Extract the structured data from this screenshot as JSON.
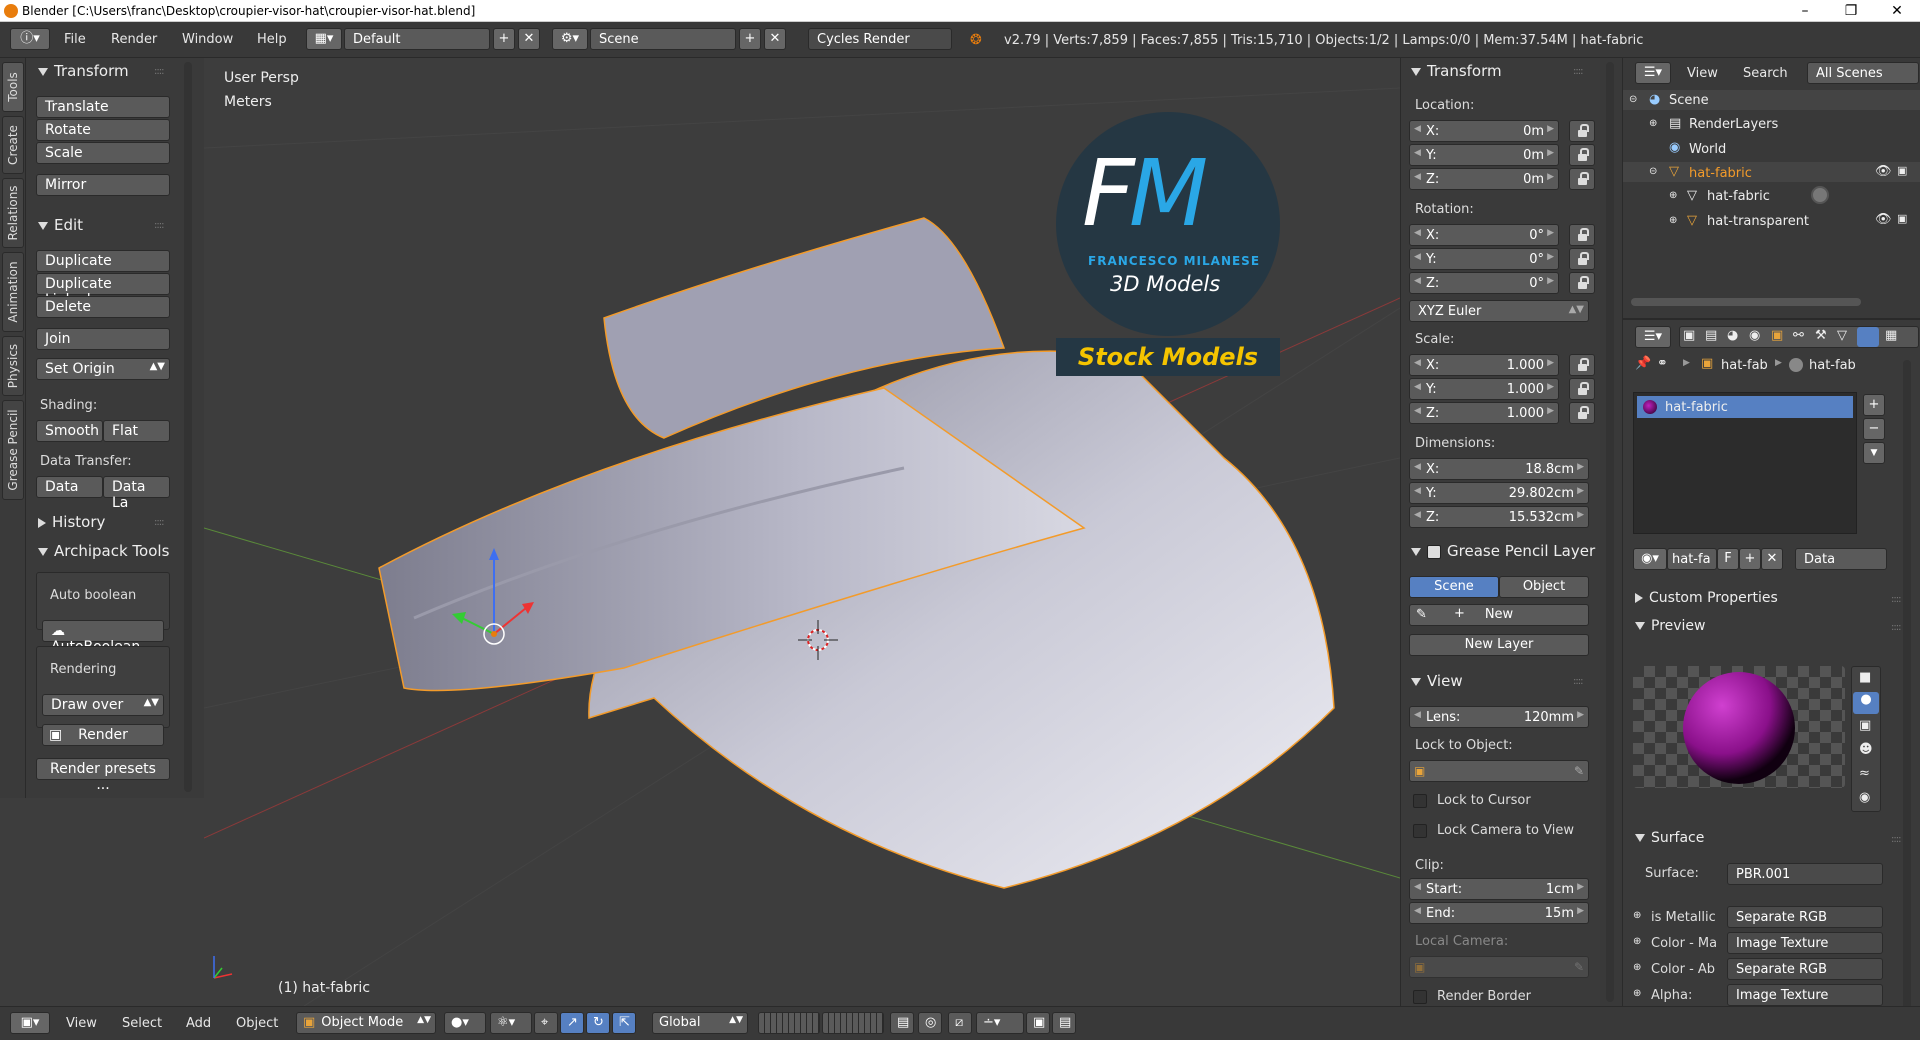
{
  "window": {
    "title": "Blender [C:\\Users\\franc\\Desktop\\croupier-visor-hat\\croupier-visor-hat.blend]",
    "minimize": "–",
    "maximize": "❐",
    "close": "✕"
  },
  "infobar": {
    "menus": [
      "File",
      "Render",
      "Window",
      "Help"
    ],
    "layout": "Default",
    "scene": "Scene",
    "engine": "Cycles Render",
    "stats": "v2.79 | Verts:7,859 | Faces:7,855 | Tris:15,710 | Objects:1/2 | Lamps:0/0 | Mem:37.54M | hat-fabric"
  },
  "tabs": [
    "Tools",
    "Create",
    "Relations",
    "Animation",
    "Physics",
    "Grease Pencil"
  ],
  "toolshelf": {
    "transform": {
      "title": "Transform",
      "buttons": [
        "Translate",
        "Rotate",
        "Scale",
        "Mirror"
      ]
    },
    "edit": {
      "title": "Edit",
      "buttons": [
        "Duplicate",
        "Duplicate Linked",
        "Delete",
        "Join"
      ],
      "set_origin": "Set Origin",
      "shading_label": "Shading:",
      "smooth": "Smooth",
      "flat": "Flat",
      "data_transfer_label": "Data Transfer:",
      "data": "Data",
      "data_la": "Data La"
    },
    "history": "History",
    "archipack": {
      "title": "Archipack Tools",
      "auto_boolean_label": "Auto boolean",
      "auto_boolean_btn": "AutoBoolean",
      "rendering_label": "Rendering",
      "draw_over": "Draw over",
      "render": "Render",
      "render_presets": "Render presets ..."
    }
  },
  "viewport": {
    "view_name": "User Persp",
    "units": "Meters",
    "object_label": "(1) hat-fabric",
    "watermark": {
      "initials": "FM",
      "author": "FRANCESCO MILANESE",
      "subtitle": "3D Models",
      "banner": "Stock Models"
    }
  },
  "npanel": {
    "transform_title": "Transform",
    "location_label": "Location:",
    "location": [
      {
        "k": "X:",
        "v": "0m"
      },
      {
        "k": "Y:",
        "v": "0m"
      },
      {
        "k": "Z:",
        "v": "0m"
      }
    ],
    "rotation_label": "Rotation:",
    "rotation": [
      {
        "k": "X:",
        "v": "0°"
      },
      {
        "k": "Y:",
        "v": "0°"
      },
      {
        "k": "Z:",
        "v": "0°"
      }
    ],
    "rotation_mode": "XYZ Euler",
    "scale_label": "Scale:",
    "scale": [
      {
        "k": "X:",
        "v": "1.000"
      },
      {
        "k": "Y:",
        "v": "1.000"
      },
      {
        "k": "Z:",
        "v": "1.000"
      }
    ],
    "dimensions_label": "Dimensions:",
    "dimensions": [
      {
        "k": "X:",
        "v": "18.8cm"
      },
      {
        "k": "Y:",
        "v": "29.802cm"
      },
      {
        "k": "Z:",
        "v": "15.532cm"
      }
    ],
    "gp_title": "Grease Pencil Layer",
    "gp_scene": "Scene",
    "gp_object": "Object",
    "gp_new": "New",
    "gp_new_layer": "New Layer",
    "view_title": "View",
    "lens": {
      "k": "Lens:",
      "v": "120mm"
    },
    "lock_to_object": "Lock to Object:",
    "lock_to_cursor": "Lock to Cursor",
    "lock_camera": "Lock Camera to View",
    "clip_label": "Clip:",
    "clip_start": {
      "k": "Start:",
      "v": "1cm"
    },
    "clip_end": {
      "k": "End:",
      "v": "15m"
    },
    "local_camera": "Local Camera:",
    "render_border": "Render Border"
  },
  "outliner": {
    "view": "View",
    "search": "Search",
    "filter": "All Scenes",
    "items": [
      "Scene",
      "RenderLayers",
      "World",
      "hat-fabric",
      "hat-fabric",
      "hat-transparent"
    ]
  },
  "props": {
    "breadcrumb_obj": "hat-fab",
    "breadcrumb_mat": "hat-fab",
    "material_slot": "hat-fabric",
    "mat_name": "hat-fa",
    "fake_user": "F",
    "link": "Data",
    "custom_props": "Custom Properties",
    "preview": "Preview",
    "surface_title": "Surface",
    "surface_label": "Surface:",
    "surface_value": "PBR.001",
    "inputs": [
      {
        "k": "is Metallic",
        "v": "Separate RGB"
      },
      {
        "k": "Color - Ma",
        "v": "Image Texture"
      },
      {
        "k": "Color - Ab",
        "v": "Separate RGB"
      },
      {
        "k": "Alpha:",
        "v": "Image Texture"
      }
    ]
  },
  "bottombar": {
    "menus": [
      "View",
      "Select",
      "Add",
      "Object"
    ],
    "mode": "Object Mode",
    "orientation": "Global"
  },
  "colors": {
    "accent": "#5680c2",
    "selected_outline": "#f39b2a",
    "bg": "#3d3d3d"
  }
}
